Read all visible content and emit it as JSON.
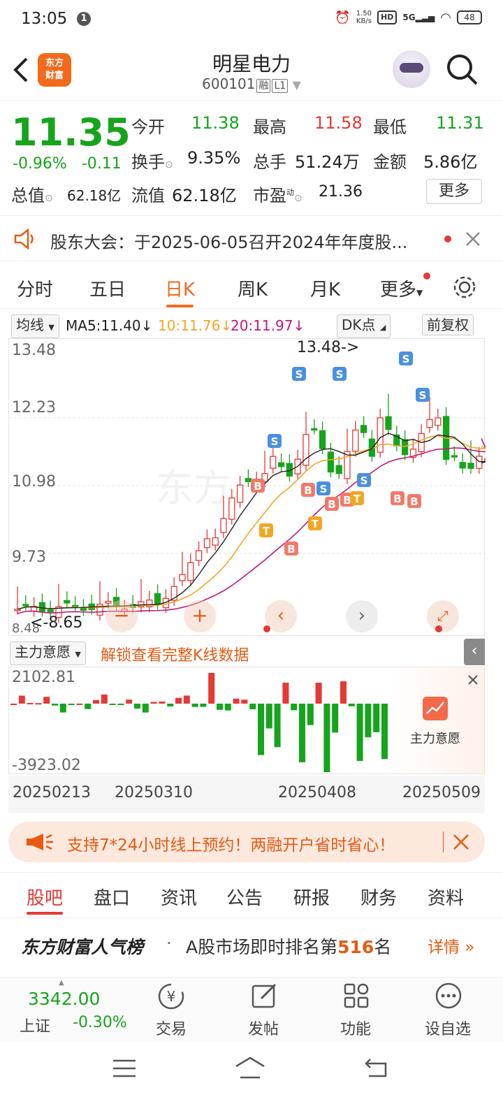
{
  "status": {
    "time": "13:05",
    "notif": "1",
    "speed_top": "1.50",
    "speed_bottom": "KB/s",
    "hd": "HD",
    "net": "5G",
    "battery": "48"
  },
  "header": {
    "logo_line1": "东方",
    "logo_line2": "财富",
    "title": "明星电力",
    "code": "600101",
    "tag1": "融",
    "tag2": "L1"
  },
  "quote": {
    "price": "11.35",
    "pct": "-0.96%",
    "chg": "-0.11",
    "open_label": "今开",
    "open": "11.38",
    "high_label": "最高",
    "high": "11.58",
    "low_label": "最低",
    "low": "11.31",
    "turnover_label": "换手",
    "turnover": "9.35%",
    "volume_label": "总手",
    "volume": "51.24万",
    "amount_label": "金额",
    "amount": "5.86亿",
    "mktcap_label": "总值",
    "mktcap": "62.18亿",
    "float_label": "流值",
    "float": "62.18亿",
    "pe_label": "市盈",
    "pe_sup": "动",
    "pe": "21.36",
    "more": "更多"
  },
  "notice": {
    "text": "股东大会：于2025-06-05召开2024年年度股..."
  },
  "ktabs": [
    "分时",
    "五日",
    "日K",
    "周K",
    "月K",
    "更多"
  ],
  "legend": {
    "ma_btn": "均线",
    "ma5": "MA5:11.40↓",
    "ma10": "10:11.76↓",
    "ma20": "20:11.97↓",
    "dk": "DK点",
    "fq": "前复权"
  },
  "chart_data": {
    "type": "candlestick",
    "y_ticks": [
      "13.48",
      "12.23",
      "10.98",
      "9.73",
      "8.48"
    ],
    "high_annotation": "13.48->",
    "low_annotation": "<-8.65",
    "dates": [
      "20250213",
      "20250310",
      "20250408",
      "20250509"
    ],
    "signals": [
      "S",
      "B",
      "T"
    ],
    "indicator_name": "主力意愿",
    "indicator_max": "2102.81",
    "indicator_min": "-3923.02"
  },
  "indicator": {
    "select": "主力意愿",
    "unlock": "解锁查看完整K线数据",
    "panel_label": "主力意愿"
  },
  "promo": {
    "text": "支持7*24小时线上预约！两融开户省时省心！"
  },
  "btabs": [
    "股吧",
    "盘口",
    "资讯",
    "公告",
    "研报",
    "财务",
    "资料"
  ],
  "rank": {
    "brand": "东方财富人气榜",
    "dot": "·",
    "text1": "A股市场即时排名第",
    "num": "516",
    "text2": "名",
    "detail": "详情 »"
  },
  "bottom": {
    "index_val": "3342.00",
    "index_name": "上证",
    "index_chg": "-0.30%",
    "trade": "交易",
    "post": "发帖",
    "func": "功能",
    "fav": "设自选"
  }
}
